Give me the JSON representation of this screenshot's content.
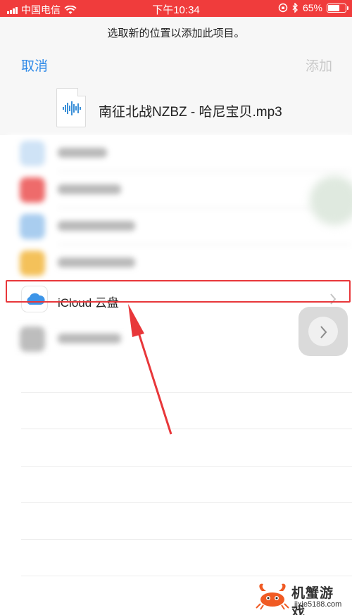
{
  "status_bar": {
    "carrier": "中国电信",
    "time": "下午10:34",
    "battery": "65%",
    "battery_level": 0.65
  },
  "sheet": {
    "prompt": "选取新的位置以添加此项目。",
    "cancel_label": "取消",
    "add_label": "添加",
    "file_name": "南征北战NZBZ - 哈尼宝贝.mp3"
  },
  "locations": [
    {
      "label": "iCloud 云盘",
      "icon": "icloud-icon"
    }
  ],
  "watermark": {
    "brand": "机蟹游戏",
    "site": "jixie5188.com"
  },
  "colors": {
    "status_bar": "#f03c3c",
    "accent": "#2f8ae8",
    "disabled": "#c8c8c8",
    "annotation": "#e8373a"
  }
}
